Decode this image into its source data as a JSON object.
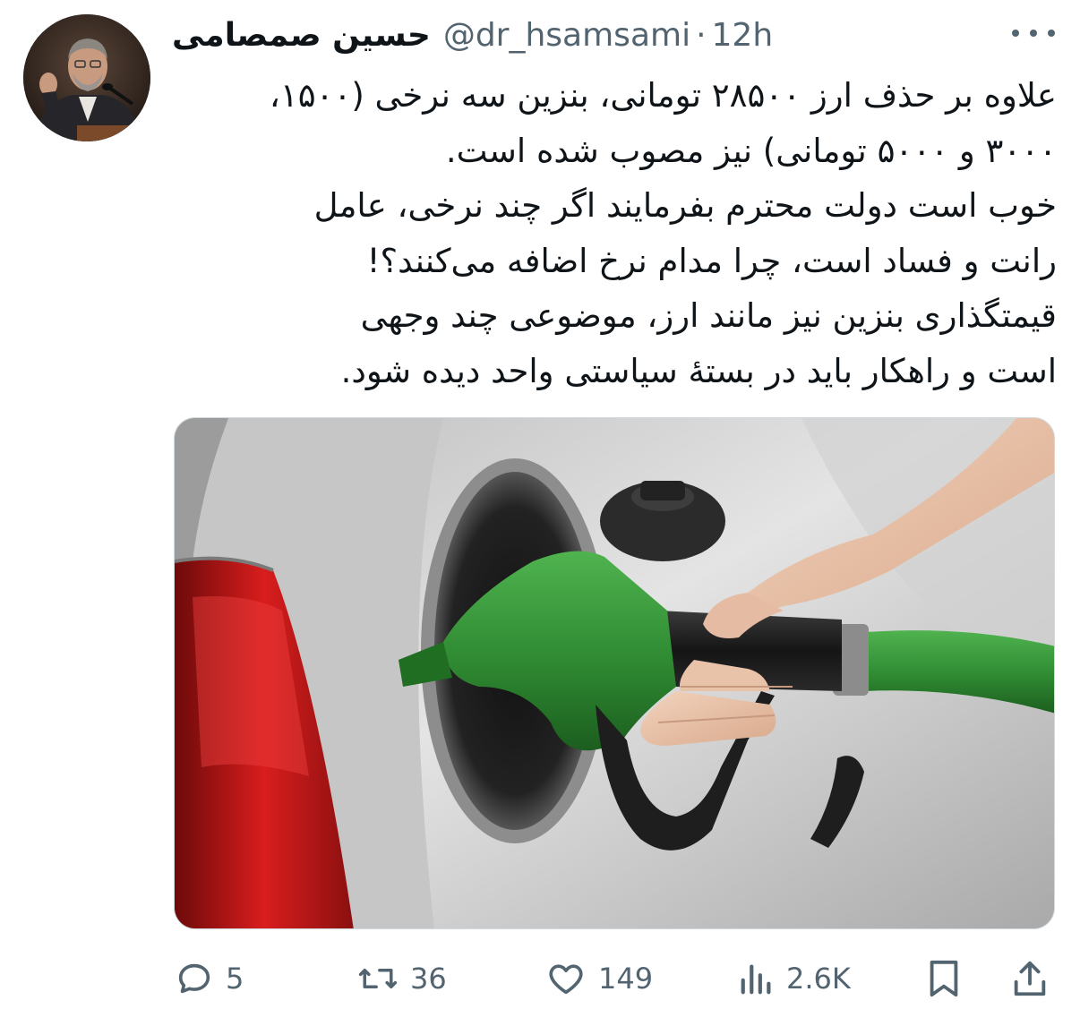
{
  "author": {
    "name": "حسین صمصامی",
    "handle": "@dr_hsamsami",
    "separator": "·",
    "time": "12h"
  },
  "tweet": {
    "lines": [
      "علاوه بر حذف ارز ۲۸۵۰۰ تومانی، بنزین سه نرخی (۱۵۰۰،",
      "۳۰۰۰ و ۵۰۰۰ تومانی) نیز مصوب شده است.",
      "خوب است دولت محترم بفرمایند اگر چند نرخی، عامل",
      "رانت و فساد است، چرا مدام نرخ اضافه می‌کنند؟!",
      "قیمتگذاری بنزین نیز مانند ارز، موضوعی چند وجهی",
      "است و راهکار باید در بستهٔ سیاستی واحد دیده شود."
    ]
  },
  "media": {
    "icon": "fuel-nozzle-photo"
  },
  "actions": {
    "replies": "5",
    "retweets": "36",
    "likes": "149",
    "views": "2.6K"
  },
  "colors": {
    "text": "#0f1419",
    "secondary": "#536471",
    "border": "#cfd9de",
    "nozzle_green": "#2f8a32"
  }
}
